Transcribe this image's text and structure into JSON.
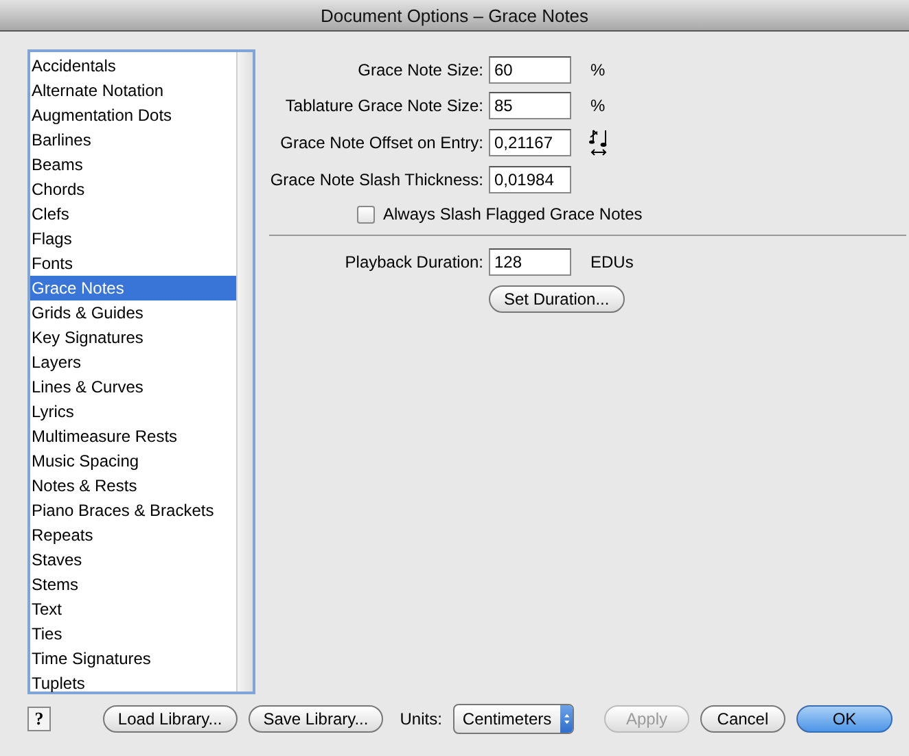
{
  "window": {
    "title": "Document Options – Grace Notes"
  },
  "categories": [
    {
      "label": "Accidentals",
      "selected": false
    },
    {
      "label": "Alternate Notation",
      "selected": false
    },
    {
      "label": "Augmentation Dots",
      "selected": false
    },
    {
      "label": "Barlines",
      "selected": false
    },
    {
      "label": "Beams",
      "selected": false
    },
    {
      "label": "Chords",
      "selected": false
    },
    {
      "label": "Clefs",
      "selected": false
    },
    {
      "label": "Flags",
      "selected": false
    },
    {
      "label": "Fonts",
      "selected": false
    },
    {
      "label": "Grace Notes",
      "selected": true
    },
    {
      "label": "Grids & Guides",
      "selected": false
    },
    {
      "label": "Key Signatures",
      "selected": false
    },
    {
      "label": "Layers",
      "selected": false
    },
    {
      "label": "Lines & Curves",
      "selected": false
    },
    {
      "label": "Lyrics",
      "selected": false
    },
    {
      "label": "Multimeasure Rests",
      "selected": false
    },
    {
      "label": "Music Spacing",
      "selected": false
    },
    {
      "label": "Notes & Rests",
      "selected": false
    },
    {
      "label": "Piano Braces & Brackets",
      "selected": false
    },
    {
      "label": "Repeats",
      "selected": false
    },
    {
      "label": "Staves",
      "selected": false
    },
    {
      "label": "Stems",
      "selected": false
    },
    {
      "label": "Text",
      "selected": false
    },
    {
      "label": "Ties",
      "selected": false
    },
    {
      "label": "Time Signatures",
      "selected": false
    },
    {
      "label": "Tuplets",
      "selected": false
    }
  ],
  "fields": [
    {
      "kind": "unit",
      "label": "Grace Note Size:",
      "value": "60",
      "unit": "%"
    },
    {
      "kind": "unit",
      "label": "Tablature Grace Note Size:",
      "value": "85",
      "unit": "%"
    },
    {
      "kind": "icon",
      "label": "Grace Note Offset on Entry:",
      "value": "0,21167"
    },
    {
      "kind": "plain",
      "label": "Grace Note Slash Thickness:",
      "value": "0,01984"
    }
  ],
  "slash_checkbox": {
    "label": "Always Slash Flagged Grace Notes",
    "checked": false
  },
  "playback": {
    "label": "Playback Duration:",
    "value": "128",
    "unit": "EDUs",
    "button": "Set Duration..."
  },
  "help_button": "?",
  "library_buttons": [
    "Load Library...",
    "Save Library..."
  ],
  "units": {
    "label": "Units:",
    "value": "Centimeters"
  },
  "buttons": [
    {
      "label": "Apply",
      "disabled": true,
      "default": false
    },
    {
      "label": "Cancel",
      "disabled": false,
      "default": false
    },
    {
      "label": "OK",
      "disabled": false,
      "default": true
    }
  ]
}
